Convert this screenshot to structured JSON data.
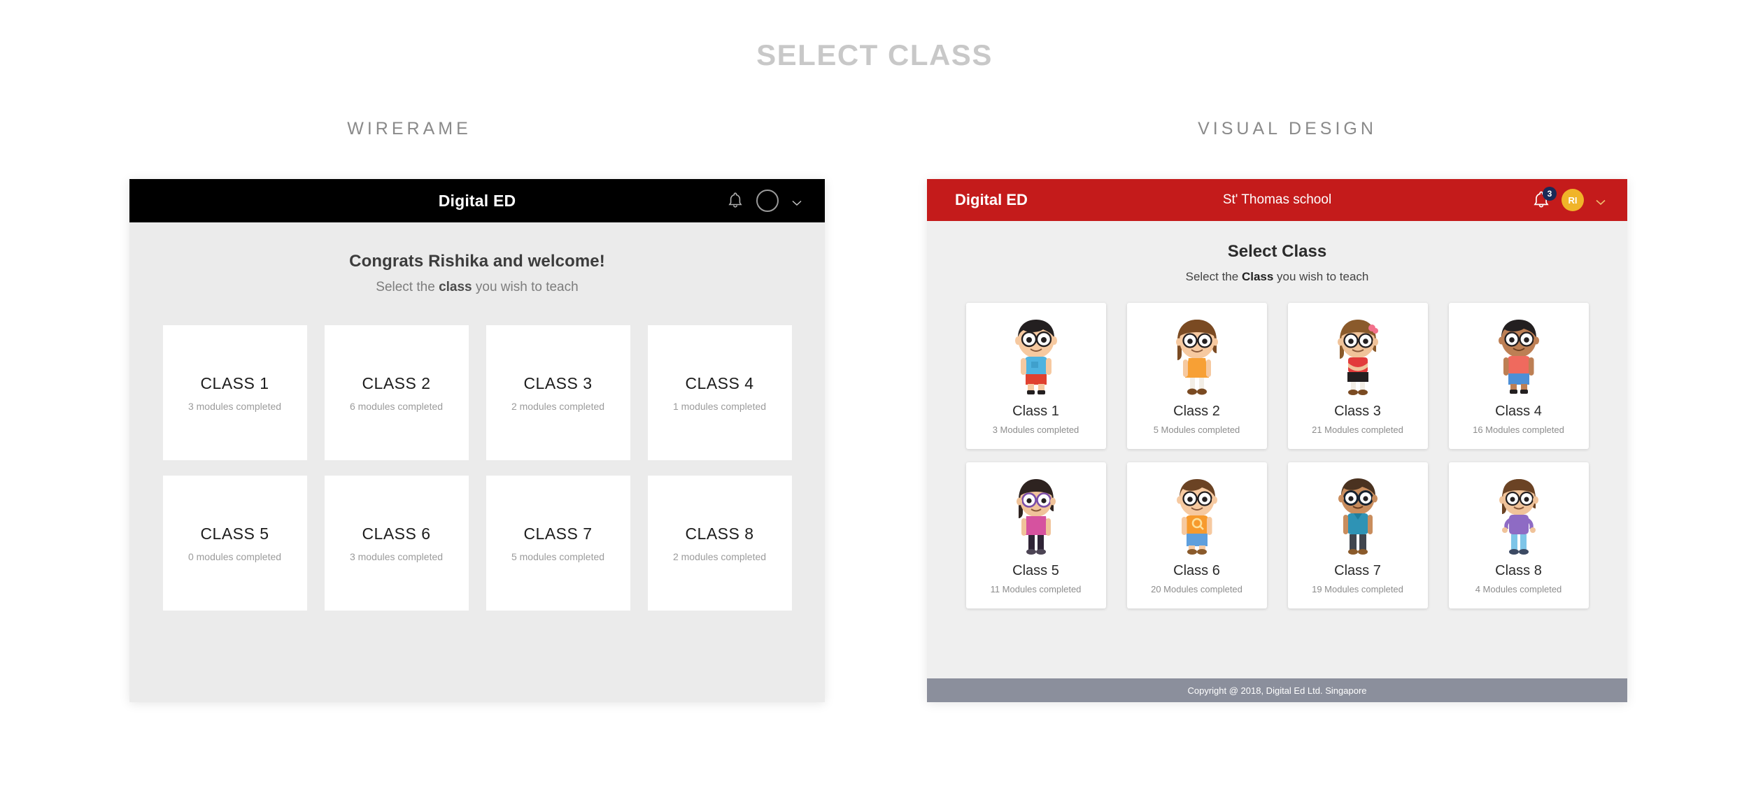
{
  "page": {
    "title": "SELECT CLASS",
    "sections": {
      "wireframe_label": "WIRERAME",
      "visual_label": "VISUAL DESIGN"
    }
  },
  "wireframe": {
    "header": {
      "brand": "Digital ED",
      "bell_icon": "bell-icon",
      "avatar_icon": "avatar-circle-icon",
      "chevron_icon": "chevron-down-icon"
    },
    "heading": "Congrats Rishika and welcome!",
    "subheading_prefix": "Select the ",
    "subheading_bold": "class",
    "subheading_suffix": " you wish to teach",
    "cards": [
      {
        "title": "CLASS 1",
        "sub": "3 modules completed"
      },
      {
        "title": "CLASS 2",
        "sub": "6 modules completed"
      },
      {
        "title": "CLASS 3",
        "sub": "2 modules completed"
      },
      {
        "title": "CLASS 4",
        "sub": "1 modules completed"
      },
      {
        "title": "CLASS 5",
        "sub": "0 modules completed"
      },
      {
        "title": "CLASS 6",
        "sub": "3 modules completed"
      },
      {
        "title": "CLASS 7",
        "sub": "5 modules completed"
      },
      {
        "title": "CLASS 8",
        "sub": "2 modules completed"
      }
    ]
  },
  "visual": {
    "header": {
      "brand": "Digital ED",
      "school": "St' Thomas school",
      "bell_icon": "bell-icon",
      "notification_count": "3",
      "avatar_initials": "RI",
      "chevron_icon": "chevron-down-icon"
    },
    "heading": "Select Class",
    "subheading_prefix": "Select the ",
    "subheading_bold": "Class",
    "subheading_suffix": " you wish to teach",
    "cards": [
      {
        "title": "Class 1",
        "sub": "3 Modules completed",
        "avatar": "boy-black-hair-blue-shirt"
      },
      {
        "title": "Class 2",
        "sub": "5 Modules completed",
        "avatar": "girl-brown-hair-orange-dress"
      },
      {
        "title": "Class 3",
        "sub": "21 Modules completed",
        "avatar": "girl-pink-bow-red-top"
      },
      {
        "title": "Class 4",
        "sub": "16 Modules completed",
        "avatar": "boy-dark-skin-coral-shirt"
      },
      {
        "title": "Class 5",
        "sub": "11 Modules completed",
        "avatar": "girl-purple-glasses-pink-top"
      },
      {
        "title": "Class 6",
        "sub": "20 Modules completed",
        "avatar": "boy-brown-hair-orange-shirt"
      },
      {
        "title": "Class 7",
        "sub": "19 Modules completed",
        "avatar": "boy-teal-shirt-grey-pants"
      },
      {
        "title": "Class 8",
        "sub": "4 Modules completed",
        "avatar": "girl-purple-top-blue-pants"
      }
    ],
    "footer": "Copyright @ 2018, Digital Ed Ltd. Singapore"
  },
  "colors": {
    "title_grey": "#c8c8c8",
    "label_grey": "#8a8a8a",
    "wireframe_header": "#000000",
    "wireframe_bg": "#ebebeb",
    "visual_header_red": "#c41b1b",
    "visual_bg": "#efefef",
    "badge_navy": "#1b2a57",
    "avatar_amber": "#f0b429",
    "footer_grey": "#8b8f9c"
  }
}
